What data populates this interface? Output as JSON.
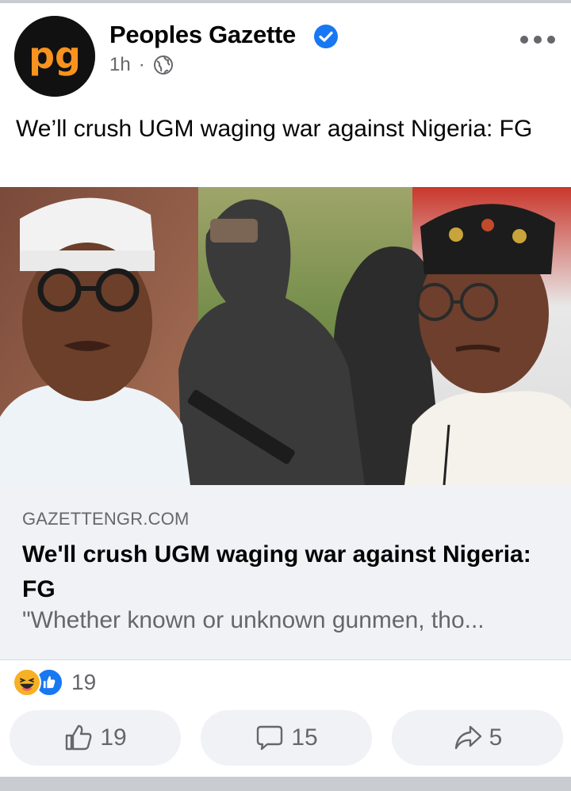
{
  "post": {
    "page_name": "Peoples Gazette",
    "time": "1h",
    "separator": "·",
    "text": "We’ll crush UGM waging war against Nigeria: FG"
  },
  "avatar": {
    "logo_text": "pg",
    "bg_color": "#111111",
    "text_color": "#f7931e"
  },
  "link": {
    "domain": "GAZETTENGR.COM",
    "title": "We'll crush UGM waging war against Nigeria: FG",
    "description": "\"Whether known or unknown gunmen, tho..."
  },
  "reactions": {
    "count": "19",
    "types": [
      "haha",
      "like"
    ]
  },
  "actions": {
    "like_count": "19",
    "comment_count": "15",
    "share_count": "5"
  },
  "colors": {
    "accent": "#1877f2",
    "muted": "#65676b",
    "surface": "#f0f2f5"
  }
}
